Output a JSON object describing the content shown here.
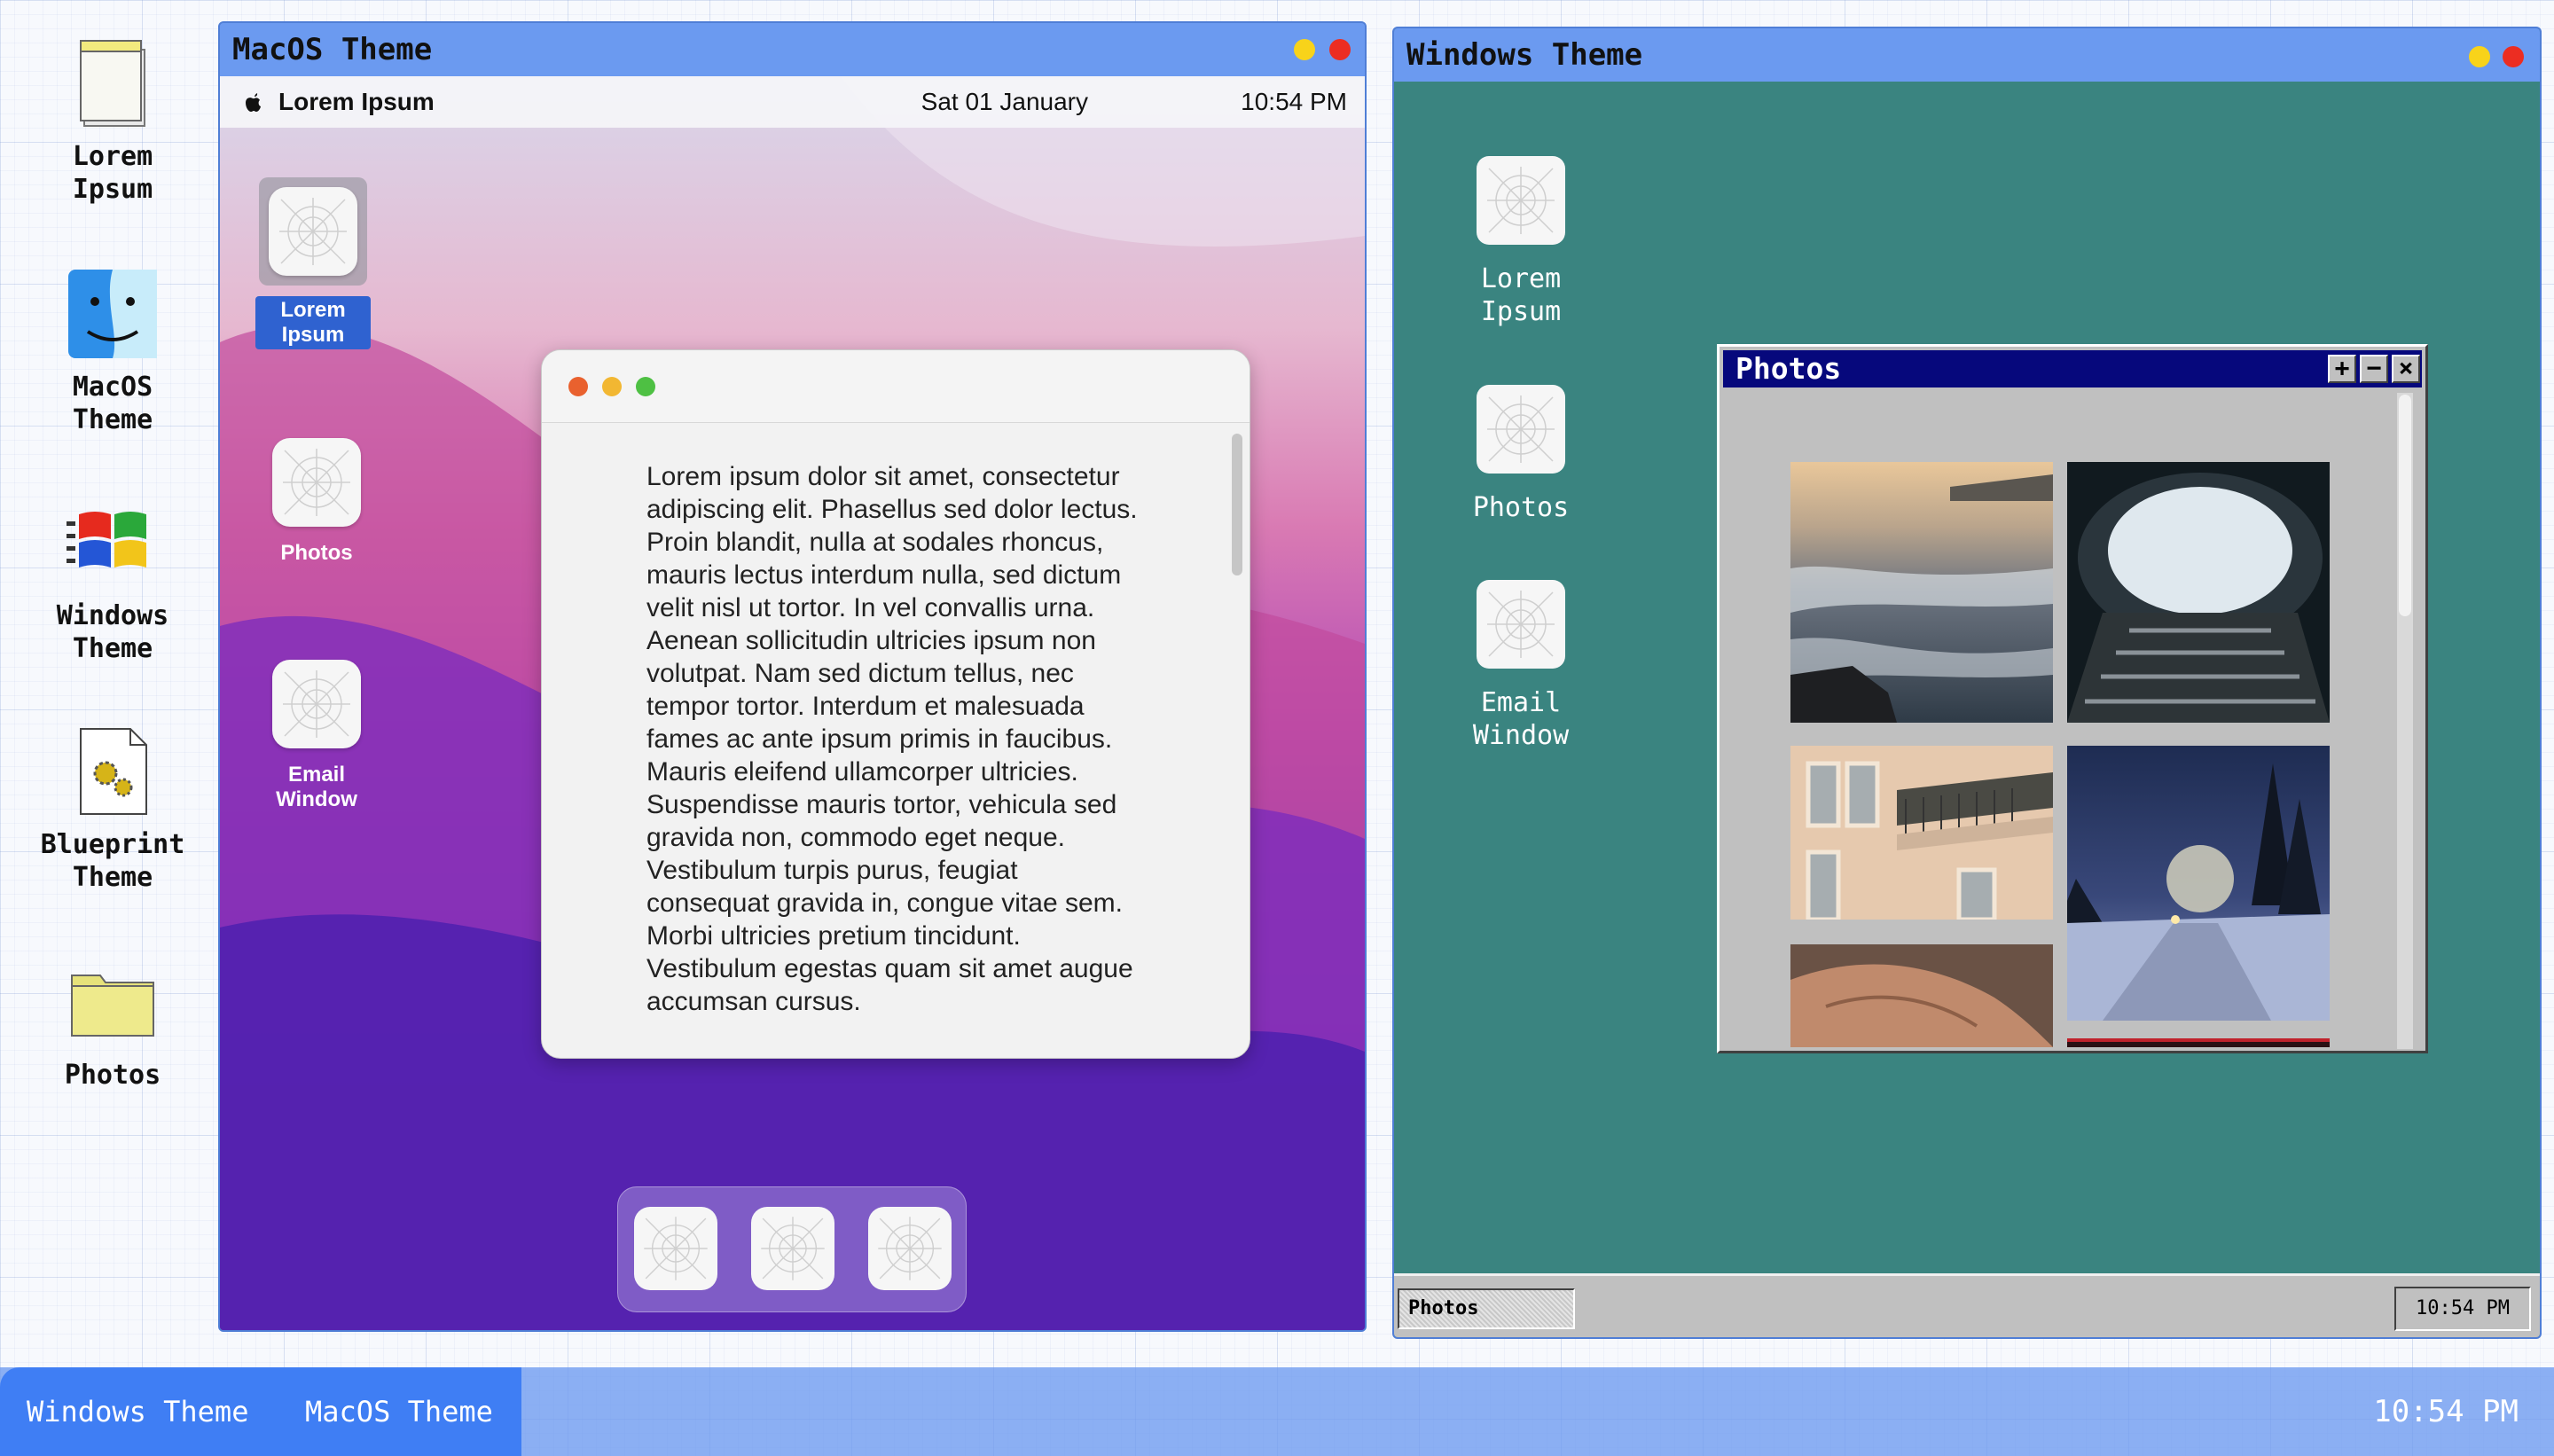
{
  "desktop_icons": [
    {
      "label_line1": "Lorem",
      "label_line2": "Ipsum",
      "icon": "notepad-icon"
    },
    {
      "label_line1": "MacOS",
      "label_line2": "Theme",
      "icon": "finder-icon"
    },
    {
      "label_line1": "Windows",
      "label_line2": "Theme",
      "icon": "windows-flag-icon"
    },
    {
      "label_line1": "Blueprint",
      "label_line2": "Theme",
      "icon": "settings-file-icon"
    },
    {
      "label_line1": "Photos",
      "label_line2": "",
      "icon": "folder-icon"
    }
  ],
  "mac_window": {
    "title": "MacOS Theme",
    "menubar": {
      "app_name": "Lorem Ipsum",
      "date": "Sat 01 January",
      "time": "10:54 PM"
    },
    "icons": [
      {
        "label_line1": "Lorem",
        "label_line2": "Ipsum"
      },
      {
        "label_line1": "Photos",
        "label_line2": ""
      },
      {
        "label_line1": "Email",
        "label_line2": "Window"
      }
    ],
    "text_window": {
      "body": "Lorem ipsum dolor sit amet, consectetur adipiscing elit. Phasellus sed dolor lectus. Proin blandit, nulla at sodales rhoncus, mauris lectus interdum nulla, sed dictum velit nisl ut tortor. In vel convallis urna. Aenean sollicitudin ultricies ipsum non volutpat. Nam sed dictum tellus, nec tempor tortor. Interdum et malesuada fames ac ante ipsum primis in faucibus. Mauris eleifend ullamcorper ultricies. Suspendisse mauris tortor, vehicula sed gravida non, commodo eget neque. Vestibulum turpis purus, feugiat consequat gravida in, congue vitae sem. Morbi ultricies pretium tincidunt. Vestibulum egestas quam sit amet augue accumsan cursus."
    }
  },
  "windows_window": {
    "title": "Windows Theme",
    "icons": [
      {
        "label_line1": "Lorem",
        "label_line2": "Ipsum"
      },
      {
        "label_line1": "Photos",
        "label_line2": ""
      },
      {
        "label_line1": "Email",
        "label_line2": "Window"
      }
    ],
    "photos_window": {
      "title": "Photos",
      "max_glyph": "+",
      "min_glyph": "−",
      "close_glyph": "×"
    },
    "taskbar": {
      "task_label": "Photos",
      "clock": "10:54 PM"
    }
  },
  "taskbar": {
    "items": [
      "Windows Theme",
      "MacOS Theme"
    ],
    "clock": "10:54 PM"
  },
  "colors": {
    "accent": "#6b9af0",
    "taskbar_active": "#3f7ef4",
    "win_desktop": "#3a8480",
    "win_titlebar": "#06087c"
  }
}
